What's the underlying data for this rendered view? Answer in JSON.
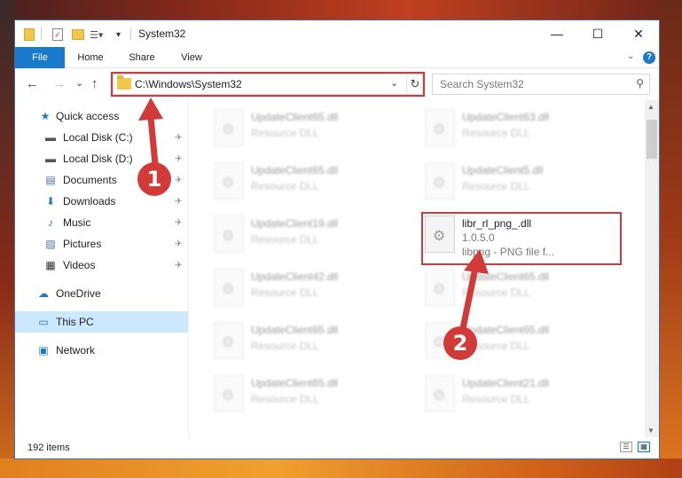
{
  "window": {
    "title": "System32"
  },
  "ribbon": {
    "tabs": [
      "File",
      "Home",
      "Share",
      "View"
    ],
    "help": "?"
  },
  "nav": {
    "back": "←",
    "forward": "→",
    "recent": "⌄",
    "up": "↑",
    "address": "C:\\Windows\\System32",
    "dropdown": "⌄",
    "refresh": "↻",
    "search_placeholder": "Search System32"
  },
  "sidebar": {
    "items": [
      {
        "label": "Quick access",
        "icon": "★"
      },
      {
        "label": "Local Disk (C:)",
        "icon": "▬"
      },
      {
        "label": "Local Disk (D:)",
        "icon": "▬"
      },
      {
        "label": "Documents",
        "icon": "▤"
      },
      {
        "label": "Downloads",
        "icon": "⬇"
      },
      {
        "label": "Music",
        "icon": "♪"
      },
      {
        "label": "Pictures",
        "icon": "▨"
      },
      {
        "label": "Videos",
        "icon": "▦"
      },
      {
        "label": "OneDrive",
        "icon": "☁"
      },
      {
        "label": "This PC",
        "icon": "▭"
      },
      {
        "label": "Network",
        "icon": "▣"
      }
    ],
    "pin": "📌"
  },
  "files": {
    "left": [
      {
        "name": "UpdateClient65.dll",
        "type": "Resource DLL"
      },
      {
        "name": "UpdateClient65.dll",
        "type": "Resource DLL"
      },
      {
        "name": "UpdateClient19.dll",
        "type": "Resource DLL"
      },
      {
        "name": "UpdateClient42.dll",
        "type": "Resource DLL"
      },
      {
        "name": "UpdateClient65.dll",
        "type": "Resource DLL"
      },
      {
        "name": "UpdateClient65.dll",
        "type": "Resource DLL"
      }
    ],
    "right": [
      {
        "name": "UpdateClient63.dll",
        "type": "Resource DLL"
      },
      {
        "name": "UpdateClient5.dll",
        "type": "Resource DLL"
      },
      {
        "name": "UpdateClient65.dll",
        "type": "Resource DLL"
      },
      {
        "name": "UpdateClient65.dll",
        "type": "Resource DLL"
      },
      {
        "name": "UpdateClient21.dll",
        "type": "Resource DLL"
      }
    ],
    "highlighted": {
      "name": "libr_rl_png_.dll",
      "version": "1.0.5.0",
      "desc": "libpng - PNG file f..."
    }
  },
  "status": {
    "count": "192 items"
  },
  "callouts": {
    "one": "1",
    "two": "2"
  },
  "colors": {
    "accent": "#1979ca",
    "highlight": "#d23a3a",
    "selected": "#cce8ff"
  }
}
